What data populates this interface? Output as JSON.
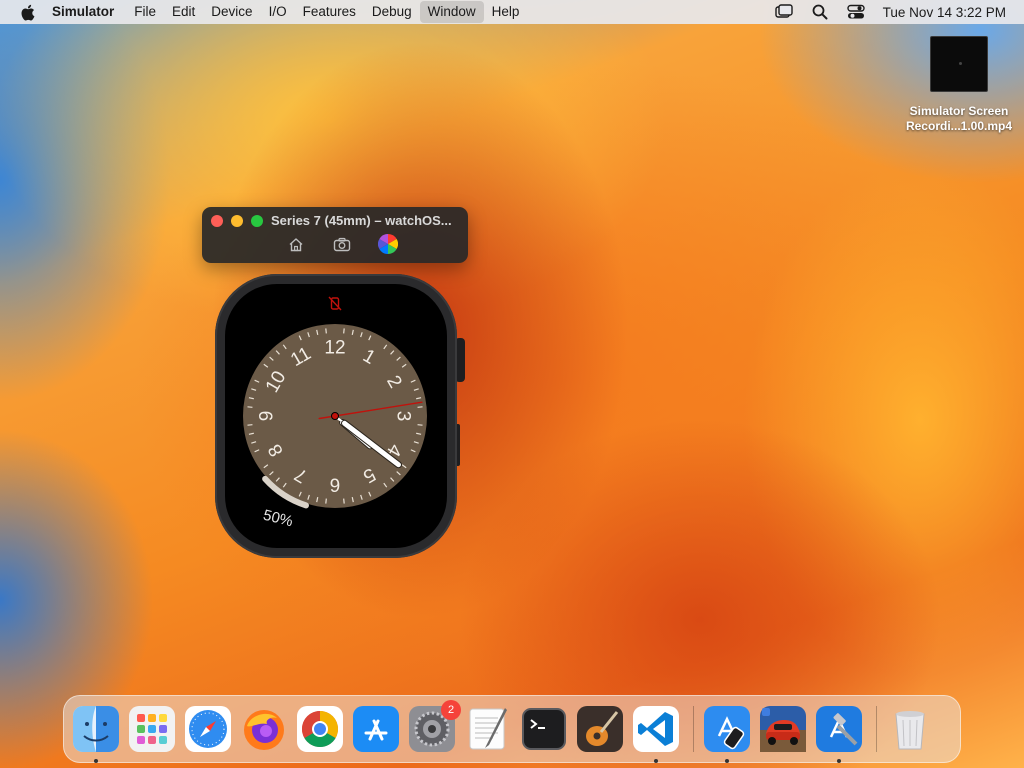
{
  "menubar": {
    "app_name": "Simulator",
    "items": [
      {
        "label": "File"
      },
      {
        "label": "Edit"
      },
      {
        "label": "Device"
      },
      {
        "label": "I/O"
      },
      {
        "label": "Features"
      },
      {
        "label": "Debug"
      },
      {
        "label": "Window",
        "active": true
      },
      {
        "label": "Help"
      }
    ],
    "right_icons": [
      "screen-mirroring-icon",
      "search-icon",
      "control-center-icon"
    ],
    "clock": "Tue Nov 14  3:22 PM"
  },
  "desktop": {
    "file": {
      "name_line1": "Simulator Screen",
      "name_line2": "Recordi...1.00.mp4"
    }
  },
  "simulator_window": {
    "title": "Series 7 (45mm) – watchOS...",
    "tools": [
      "home-icon",
      "screenshot-icon",
      "rotate-device-icon"
    ]
  },
  "watch_face": {
    "dial_numbers": [
      "12",
      "1",
      "2",
      "3",
      "4",
      "5",
      "6",
      "7",
      "8",
      "9",
      "10",
      "11"
    ],
    "battery_percent": "50%",
    "battery_level": 0.5,
    "time": {
      "hour": 4,
      "minute": 21,
      "second": 15
    },
    "colors": {
      "dial": "#6b5a47",
      "hands": "#ffffff",
      "second_hand": "#c0120c",
      "top_icon": "#c0120c"
    }
  },
  "dock": {
    "apps": [
      {
        "name": "finder",
        "running": true
      },
      {
        "name": "launchpad",
        "running": false
      },
      {
        "name": "safari",
        "running": false
      },
      {
        "name": "firefox",
        "running": false
      },
      {
        "name": "chrome",
        "running": false
      },
      {
        "name": "app-store",
        "running": false
      },
      {
        "name": "system-settings",
        "running": false,
        "badge": "2"
      },
      {
        "name": "textedit",
        "running": false
      },
      {
        "name": "terminal",
        "running": false
      },
      {
        "name": "garageband",
        "running": false
      },
      {
        "name": "vscode",
        "running": true
      }
    ],
    "recent_apps": [
      {
        "name": "simulator",
        "running": true
      },
      {
        "name": "racing-game",
        "running": false
      },
      {
        "name": "xcode",
        "running": true
      }
    ],
    "trash": {
      "name": "trash"
    }
  }
}
